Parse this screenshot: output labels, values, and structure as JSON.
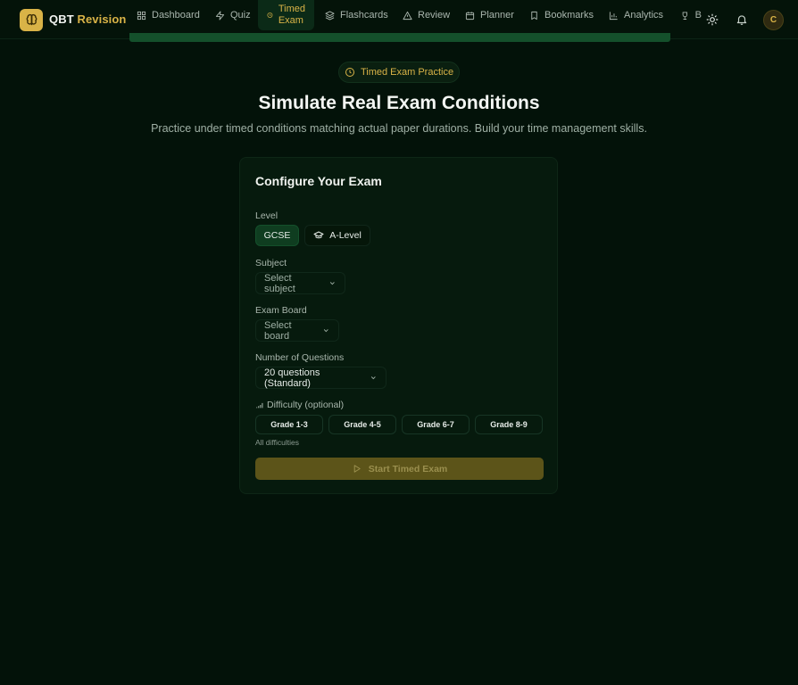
{
  "brand": {
    "name_part1": "QBT",
    "name_part2": "Revision",
    "logo_icon": "brain-icon",
    "accent": "#d9b347"
  },
  "nav": {
    "items": [
      {
        "label": "Dashboard",
        "icon": "grid-icon"
      },
      {
        "label": "Quiz",
        "icon": "zap-icon"
      },
      {
        "label_line1": "Timed",
        "label_line2": "Exam",
        "icon": "clock-icon",
        "active": true
      },
      {
        "label": "Flashcards",
        "icon": "layers-icon"
      },
      {
        "label": "Review",
        "icon": "alert-triangle-icon"
      },
      {
        "label": "Planner",
        "icon": "calendar-icon"
      },
      {
        "label": "Bookmarks",
        "icon": "bookmark-icon"
      },
      {
        "label": "Analytics",
        "icon": "bar-chart-icon"
      },
      {
        "label": "B",
        "icon": "trophy-icon"
      }
    ]
  },
  "header_actions": {
    "theme_icon": "sun-icon",
    "notifications_icon": "bell-icon",
    "avatar_initial": "C"
  },
  "hero": {
    "badge": "Timed Exam Practice",
    "title": "Simulate Real Exam Conditions",
    "subtitle": "Practice under timed conditions matching actual paper durations. Build your time management skills."
  },
  "config": {
    "title": "Configure Your Exam",
    "level": {
      "label": "Level",
      "options": [
        "GCSE",
        "A-Level"
      ],
      "selected": "GCSE"
    },
    "subject": {
      "label": "Subject",
      "placeholder": "Select subject"
    },
    "board": {
      "label": "Exam Board",
      "placeholder": "Select board"
    },
    "questions": {
      "label": "Number of Questions",
      "value": "20 questions (Standard)"
    },
    "difficulty": {
      "label": "Difficulty (optional)",
      "options": [
        "Grade 1-3",
        "Grade 4-5",
        "Grade 6-7",
        "Grade 8-9"
      ],
      "hint": "All difficulties"
    },
    "start_label": "Start Timed Exam"
  }
}
